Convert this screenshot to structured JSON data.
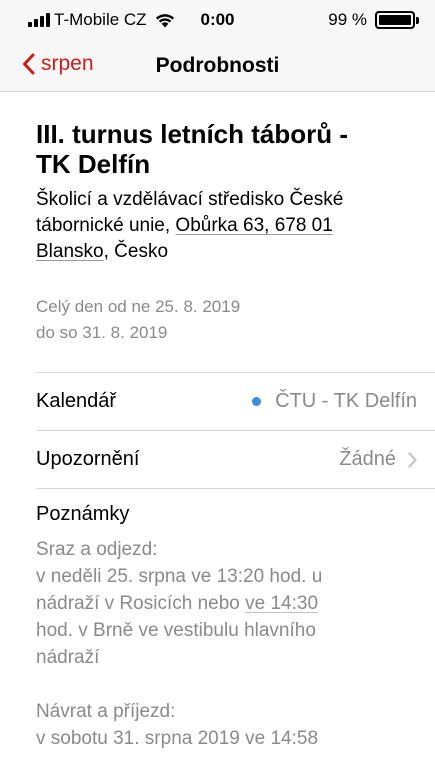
{
  "status_bar": {
    "carrier": "T-Mobile CZ",
    "time": "0:00",
    "battery": "99 %",
    "battery_level": 0.99
  },
  "nav": {
    "back_label": "srpen",
    "title": "Podrobnosti"
  },
  "event": {
    "title_line1": "III. turnus letních táborů -",
    "title_line2": "TK Delfín",
    "location_line1": "Školicí a vzdělávací středisko České",
    "location_line2_prefix": "tábornické unie, ",
    "location_line2_address": "Obůrka 63, 678 01",
    "location_line3_city": "Blansko",
    "location_line3_suffix": ", Česko",
    "date_line1": "Celý den od ne 25. 8. 2019",
    "date_line2": "do so 31. 8. 2019"
  },
  "calendar_row": {
    "label": "Kalendář",
    "value": "ČTU - TK Delfín",
    "dot_color": "#3d8be0"
  },
  "alert_row": {
    "label": "Upozornění",
    "value": "Žádné"
  },
  "notes": {
    "label": "Poznámky",
    "p1_line1": "Sraz a odjezd:",
    "p1_line2": "v neděli 25. srpna ve 13:20 hod. u",
    "p1_line3_prefix": "nádraží v Rosicích nebo ",
    "p1_line3_link": "ve 14:30",
    "p1_line4": "hod. v Brně ve vestibulu hlavního",
    "p1_line5": "nádraží",
    "p2_line1": "Návrat a příjezd:",
    "p2_line2": "v sobotu 31. srpna 2019 ve 14:58"
  },
  "accent_color": "#d11a1a"
}
